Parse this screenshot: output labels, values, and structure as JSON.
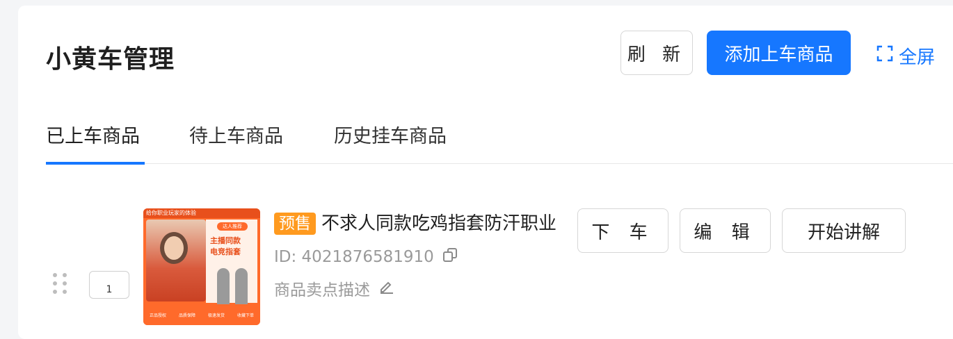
{
  "header": {
    "title": "小黄车管理",
    "refresh_label": "刷 新",
    "add_label": "添加上车商品",
    "fullscreen_label": "全屏"
  },
  "tabs": [
    {
      "label": "已上车商品",
      "active": true
    },
    {
      "label": "待上车商品",
      "active": false
    },
    {
      "label": "历史挂车商品",
      "active": false
    }
  ],
  "product": {
    "sequence": "1",
    "presale_badge": "预售",
    "title": "不求人同款吃鸡指套防汗职业",
    "id_text": "ID: 4021876581910",
    "desc_placeholder": "商品卖点描述",
    "image_texts": {
      "top_strip": "给你职业玩家的体验",
      "tag": "达人推荐",
      "line1": "主播同款",
      "line2": "电竞指套",
      "bottom": [
        "正品授权",
        "品质保障",
        "极速发货",
        "收藏下单"
      ]
    },
    "actions": {
      "off_car": "下 车",
      "edit": "编 辑",
      "explain": "开始讲解"
    }
  },
  "colors": {
    "accent": "#1677ff",
    "presale": "#ff9a1f",
    "muted": "#9a9a9a"
  },
  "icons": [
    "fullscreen-icon",
    "copy-icon",
    "edit-pencil-icon",
    "drag-handle-icon"
  ]
}
